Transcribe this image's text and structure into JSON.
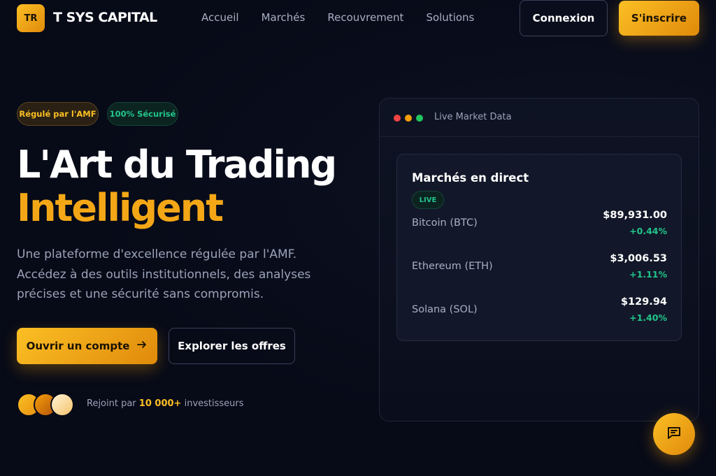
{
  "header": {
    "logo_text": "TR",
    "brand": "T SYS CAPITAL",
    "nav": [
      "Accueil",
      "Marchés",
      "Recouvrement",
      "Solutions"
    ],
    "login_label": "Connexion",
    "signup_label": "S'inscrire"
  },
  "badges": {
    "amf": "Régulé par l'AMF",
    "secure": "100% Sécurisé"
  },
  "hero": {
    "title_line1": "L'Art du Trading",
    "title_line2": "Intelligent",
    "description": "Une plateforme d'excellence régulée par l'AMF. Accédez à des outils institutionnels, des analyses précises et une sécurité sans compromis.",
    "cta_primary": "Ouvrir un compte",
    "cta_secondary": "Explorer les offres"
  },
  "social_proof": {
    "prefix": "Rejoint par",
    "count": "10 000+",
    "suffix": "investisseurs"
  },
  "market_window": {
    "title": "Live Market Data",
    "card_title": "Marchés en direct",
    "live_badge": "LIVE",
    "assets": [
      {
        "name": "Bitcoin (BTC)",
        "price": "$89,931.00",
        "change": "+0.44%"
      },
      {
        "name": "Ethereum (ETH)",
        "price": "$3,006.53",
        "change": "+1.11%"
      },
      {
        "name": "Solana (SOL)",
        "price": "$129.94",
        "change": "+1.40%"
      }
    ]
  },
  "colors": {
    "background": "#070a17",
    "accent": "#f4a716",
    "positive": "#22c58b"
  },
  "icons": {
    "arrow": "arrow-right-icon",
    "chat": "chat-bubble-icon"
  }
}
